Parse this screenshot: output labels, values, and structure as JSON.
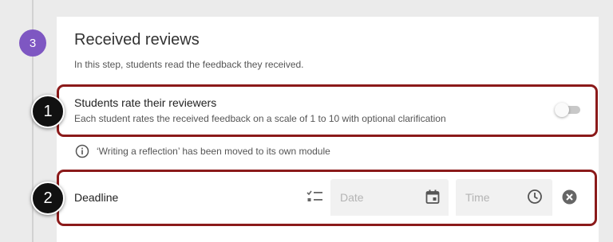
{
  "step": {
    "number": "3",
    "title": "Received reviews",
    "description": "In this step, students read the feedback they received."
  },
  "rate_option": {
    "title": "Students rate their reviewers",
    "description": "Each student rates the received feedback on a scale of 1 to 10 with optional clarification",
    "enabled": false
  },
  "info": {
    "text": "‘Writing a reflection’ has been moved to its own module",
    "icon": "info-icon"
  },
  "deadline": {
    "label": "Deadline",
    "date_placeholder": "Date",
    "time_placeholder": "Time",
    "icons": [
      "checklist-icon",
      "calendar-icon",
      "clock-icon",
      "clear-icon"
    ]
  },
  "callouts": [
    "1",
    "2"
  ],
  "colors": {
    "accent": "#7e57c2",
    "highlight": "#8b1a1a",
    "callout": "#111111"
  }
}
